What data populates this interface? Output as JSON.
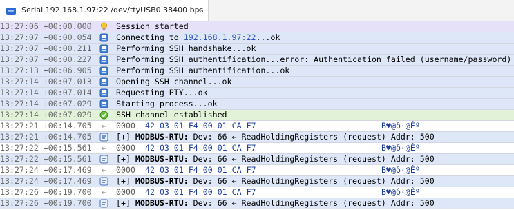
{
  "tab": {
    "title": "Serial 192.168.1.97:22 /dev/ttyUSB0 38400 bps",
    "close": "✕"
  },
  "log": [
    {
      "kind": "start",
      "ts": "13:27:06 +00:00.000",
      "icon": "bulb-icon",
      "pre": "Session started"
    },
    {
      "kind": "info",
      "ts": "13:27:07 +00:00.054",
      "icon": "session-icon",
      "pre": "Connecting to ",
      "hl": "192.168.1.97:22",
      "post": "...ok"
    },
    {
      "kind": "info",
      "ts": "13:27:07 +00:00.211",
      "icon": "session-icon",
      "pre": "Performing SSH handshake...ok"
    },
    {
      "kind": "info",
      "ts": "13:27:07 +00:00.227",
      "icon": "session-icon",
      "pre": "Performing SSH authentification...error: Authentication failed (username/password)"
    },
    {
      "kind": "info",
      "ts": "13:27:13 +00:06.905",
      "icon": "session-icon",
      "pre": "Performing SSH authentification...ok"
    },
    {
      "kind": "info",
      "ts": "13:27:14 +00:07.013",
      "icon": "session-icon",
      "pre": "Opening SSH channel...ok"
    },
    {
      "kind": "info",
      "ts": "13:27:14 +00:07.014",
      "icon": "session-icon",
      "pre": "Requesting PTY...ok"
    },
    {
      "kind": "info",
      "ts": "13:27:14 +00:07.029",
      "icon": "session-icon",
      "pre": "Starting process...ok"
    },
    {
      "kind": "ok",
      "ts": "13:27:14 +00:07.029",
      "icon": "connected-icon",
      "pre": "SSH channel established"
    },
    {
      "kind": "data",
      "ts": "13:27:21 +00:14.705",
      "arrow": "←",
      "offset": "0000",
      "hex": "42 03 01 F4 00 01 CA F7",
      "ascii": "B♥@ô·@Êº"
    },
    {
      "kind": "decode",
      "ts": "13:27:21 +00:14.705",
      "icon": "protocol-icon",
      "pre": "[+] ",
      "bold": "MODBUS-RTU:",
      "post": " Dev: 66 ← ReadHoldingRegisters (request) Addr: 500"
    },
    {
      "kind": "data",
      "ts": "13:27:22 +00:15.561",
      "arrow": "←",
      "offset": "0000",
      "hex": "42 03 01 F4 00 01 CA F7",
      "ascii": "B♥@ô·@Êº"
    },
    {
      "kind": "decode",
      "ts": "13:27:22 +00:15.561",
      "icon": "protocol-icon",
      "pre": "[+] ",
      "bold": "MODBUS-RTU:",
      "post": " Dev: 66 ← ReadHoldingRegisters (request) Addr: 500"
    },
    {
      "kind": "data",
      "ts": "13:27:24 +00:17.469",
      "arrow": "←",
      "offset": "0000",
      "hex": "42 03 01 F4 00 01 CA F7",
      "ascii": "B♥@ô·@Êº"
    },
    {
      "kind": "decode",
      "ts": "13:27:24 +00:17.469",
      "icon": "protocol-icon",
      "pre": "[+] ",
      "bold": "MODBUS-RTU:",
      "post": " Dev: 66 ← ReadHoldingRegisters (request) Addr: 500"
    },
    {
      "kind": "data",
      "ts": "13:27:26 +00:19.700",
      "arrow": "←",
      "offset": "0000",
      "hex": "42 03 01 F4 00 01 CA F7",
      "ascii": "B♥@ô·@Êº"
    },
    {
      "kind": "decode",
      "ts": "13:27:26 +00:19.700",
      "icon": "protocol-icon",
      "pre": "[+] ",
      "bold": "MODBUS-RTU:",
      "post": " Dev: 66 ← ReadHoldingRegisters (request) Addr: 500"
    }
  ]
}
